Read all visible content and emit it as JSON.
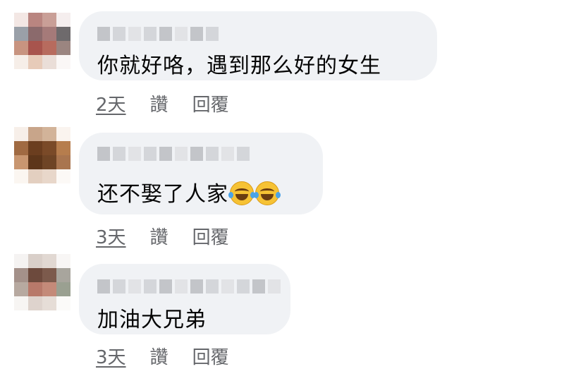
{
  "comments": [
    {
      "text": "你就好咯，遇到那么好的女生",
      "time": "2天",
      "like": "讚",
      "reply": "回覆"
    },
    {
      "text": "还不娶了人家",
      "emoji": "face-with-tears-of-joy-icon",
      "time": "3天",
      "like": "讚",
      "reply": "回覆"
    },
    {
      "text": "加油大兄弟",
      "time": "3天",
      "like": "讚",
      "reply": "回覆"
    }
  ],
  "colors": {
    "bubble": "#f0f2f5",
    "meta_text": "#65676b",
    "body_text": "#050505"
  }
}
